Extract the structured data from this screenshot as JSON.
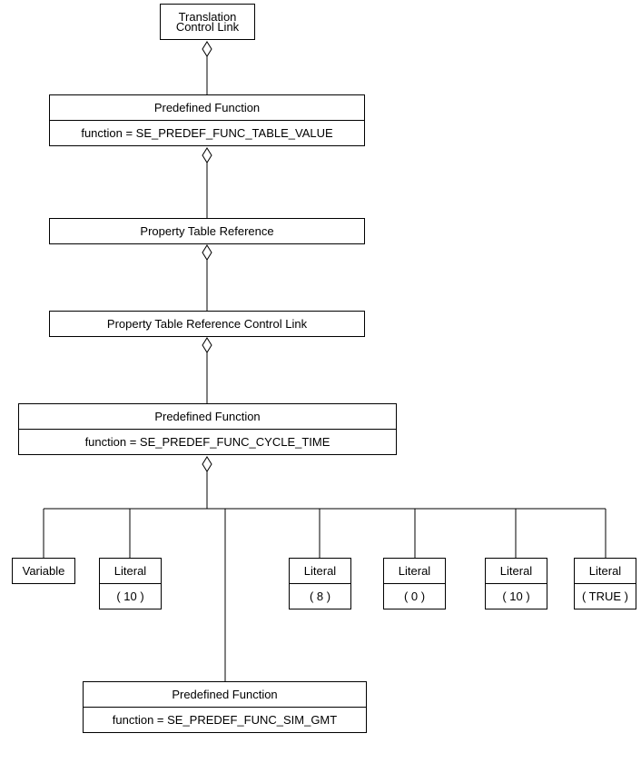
{
  "nodes": {
    "tcl": {
      "title": "Translation",
      "subtitle": "Control Link"
    },
    "pf1": {
      "title": "Predefined Function",
      "attr": "function = SE_PREDEF_FUNC_TABLE_VALUE"
    },
    "ptr": {
      "title": "Property Table Reference"
    },
    "ptrcl": {
      "title": "Property Table Reference Control Link"
    },
    "pf2": {
      "title": "Predefined Function",
      "attr": "function = SE_PREDEF_FUNC_CYCLE_TIME"
    },
    "var": {
      "title": "Variable"
    },
    "lit1": {
      "title": "Literal",
      "val": "( 10 )"
    },
    "lit2": {
      "title": "Literal",
      "val": "( 8 )"
    },
    "lit3": {
      "title": "Literal",
      "val": "( 0 )"
    },
    "lit4": {
      "title": "Literal",
      "val": "( 10 )"
    },
    "lit5": {
      "title": "Literal",
      "val": "( TRUE )"
    },
    "pf3": {
      "title": "Predefined Function",
      "attr": "function = SE_PREDEF_FUNC_SIM_GMT"
    }
  }
}
